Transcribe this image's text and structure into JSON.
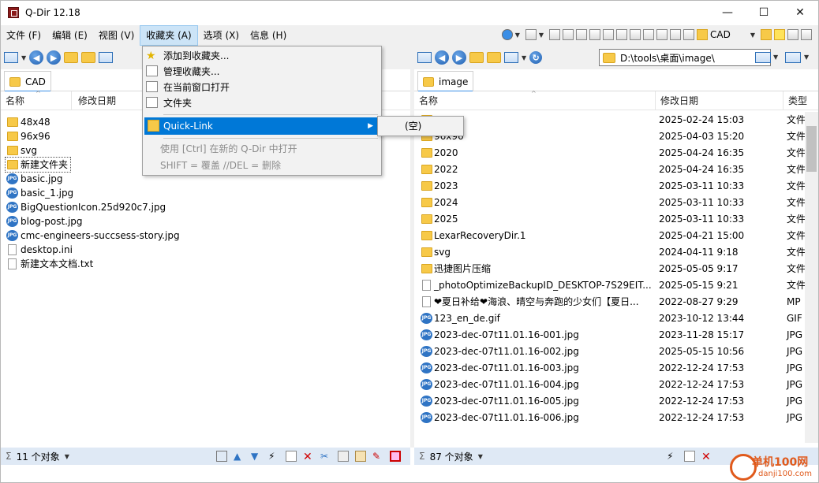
{
  "window": {
    "title": "Q-Dir 12.18"
  },
  "menubar": {
    "items": [
      "文件 (F)",
      "编辑 (E)",
      "视图 (V)",
      "收藏夹 (A)",
      "选项 (X)",
      "信息 (H)"
    ],
    "active": "收藏夹 (A)"
  },
  "toolbar": {
    "cad_label": "CAD"
  },
  "left": {
    "tab": "CAD",
    "columns": {
      "name": "名称",
      "date": "修改日期"
    },
    "rows": [
      {
        "name": "48x48",
        "kind": "folder"
      },
      {
        "name": "96x96",
        "kind": "folder"
      },
      {
        "name": "svg",
        "kind": "folder"
      },
      {
        "name": "新建文件夹",
        "kind": "folder"
      },
      {
        "name": "basic.jpg",
        "kind": "jpg"
      },
      {
        "name": "basic_1.jpg",
        "kind": "jpg"
      },
      {
        "name": "BigQuestionIcon.25d920c7.jpg",
        "kind": "jpg"
      },
      {
        "name": "blog-post.jpg",
        "kind": "jpg"
      },
      {
        "name": "cmc-engineers-succsess-story.jpg",
        "kind": "jpg"
      },
      {
        "name": "desktop.ini",
        "kind": "doc"
      },
      {
        "name": "新建文本文档.txt",
        "kind": "doc"
      }
    ],
    "status": "11 个对象"
  },
  "right": {
    "address": "D:\\tools\\桌面\\image\\",
    "tab": "image",
    "columns": {
      "name": "名称",
      "date": "修改日期",
      "type": "类型"
    },
    "rows": [
      {
        "name": "",
        "date": "2025-02-24 15:03",
        "type": "文件",
        "kind": "folder"
      },
      {
        "name": "96x96",
        "date": "2025-04-03 15:20",
        "type": "文件",
        "kind": "folder"
      },
      {
        "name": "2020",
        "date": "2025-04-24 16:35",
        "type": "文件",
        "kind": "folder"
      },
      {
        "name": "2022",
        "date": "2025-04-24 16:35",
        "type": "文件",
        "kind": "folder"
      },
      {
        "name": "2023",
        "date": "2025-03-11 10:33",
        "type": "文件",
        "kind": "folder"
      },
      {
        "name": "2024",
        "date": "2025-03-11 10:33",
        "type": "文件",
        "kind": "folder"
      },
      {
        "name": "2025",
        "date": "2025-03-11 10:33",
        "type": "文件",
        "kind": "folder"
      },
      {
        "name": "LexarRecoveryDir.1",
        "date": "2025-04-21 15:00",
        "type": "文件",
        "kind": "folder"
      },
      {
        "name": "svg",
        "date": "2024-04-11 9:18",
        "type": "文件",
        "kind": "folder"
      },
      {
        "name": "迅捷图片压缩",
        "date": "2025-05-05 9:17",
        "type": "文件",
        "kind": "folder"
      },
      {
        "name": "_photoOptimizeBackupID_DESKTOP-7S29EIT...",
        "date": "2025-05-15 9:21",
        "type": "文件",
        "kind": "doc"
      },
      {
        "name": "❤夏日补给❤海浪、晴空与奔跑的少女们【夏日...",
        "date": "2022-08-27 9:29",
        "type": "MP",
        "kind": "doc"
      },
      {
        "name": "123_en_de.gif",
        "date": "2023-10-12 13:44",
        "type": "GIF",
        "kind": "jpg"
      },
      {
        "name": "2023-dec-07t11.01.16-001.jpg",
        "date": "2023-11-28 15:17",
        "type": "JPG",
        "kind": "jpg"
      },
      {
        "name": "2023-dec-07t11.01.16-002.jpg",
        "date": "2025-05-15 10:56",
        "type": "JPG",
        "kind": "jpg"
      },
      {
        "name": "2023-dec-07t11.01.16-003.jpg",
        "date": "2022-12-24 17:53",
        "type": "JPG",
        "kind": "jpg"
      },
      {
        "name": "2023-dec-07t11.01.16-004.jpg",
        "date": "2022-12-24 17:53",
        "type": "JPG",
        "kind": "jpg"
      },
      {
        "name": "2023-dec-07t11.01.16-005.jpg",
        "date": "2022-12-24 17:53",
        "type": "JPG",
        "kind": "jpg"
      },
      {
        "name": "2023-dec-07t11.01.16-006.jpg",
        "date": "2022-12-24 17:53",
        "type": "JPG",
        "kind": "jpg"
      }
    ],
    "status": "87 个对象"
  },
  "favorites_menu": {
    "add": "添加到收藏夹...",
    "manage": "管理收藏夹...",
    "open_here": "在当前窗口打开",
    "folder": "文件夹",
    "quick_link": "Quick-Link",
    "hint1": "使用 [Ctrl] 在新的 Q-Dir 中打开",
    "hint2": "SHIFT = 覆盖 //DEL = 删除",
    "submenu_empty": "(空)"
  },
  "watermark": {
    "brand": "单机100网",
    "url": "danji100.com"
  }
}
